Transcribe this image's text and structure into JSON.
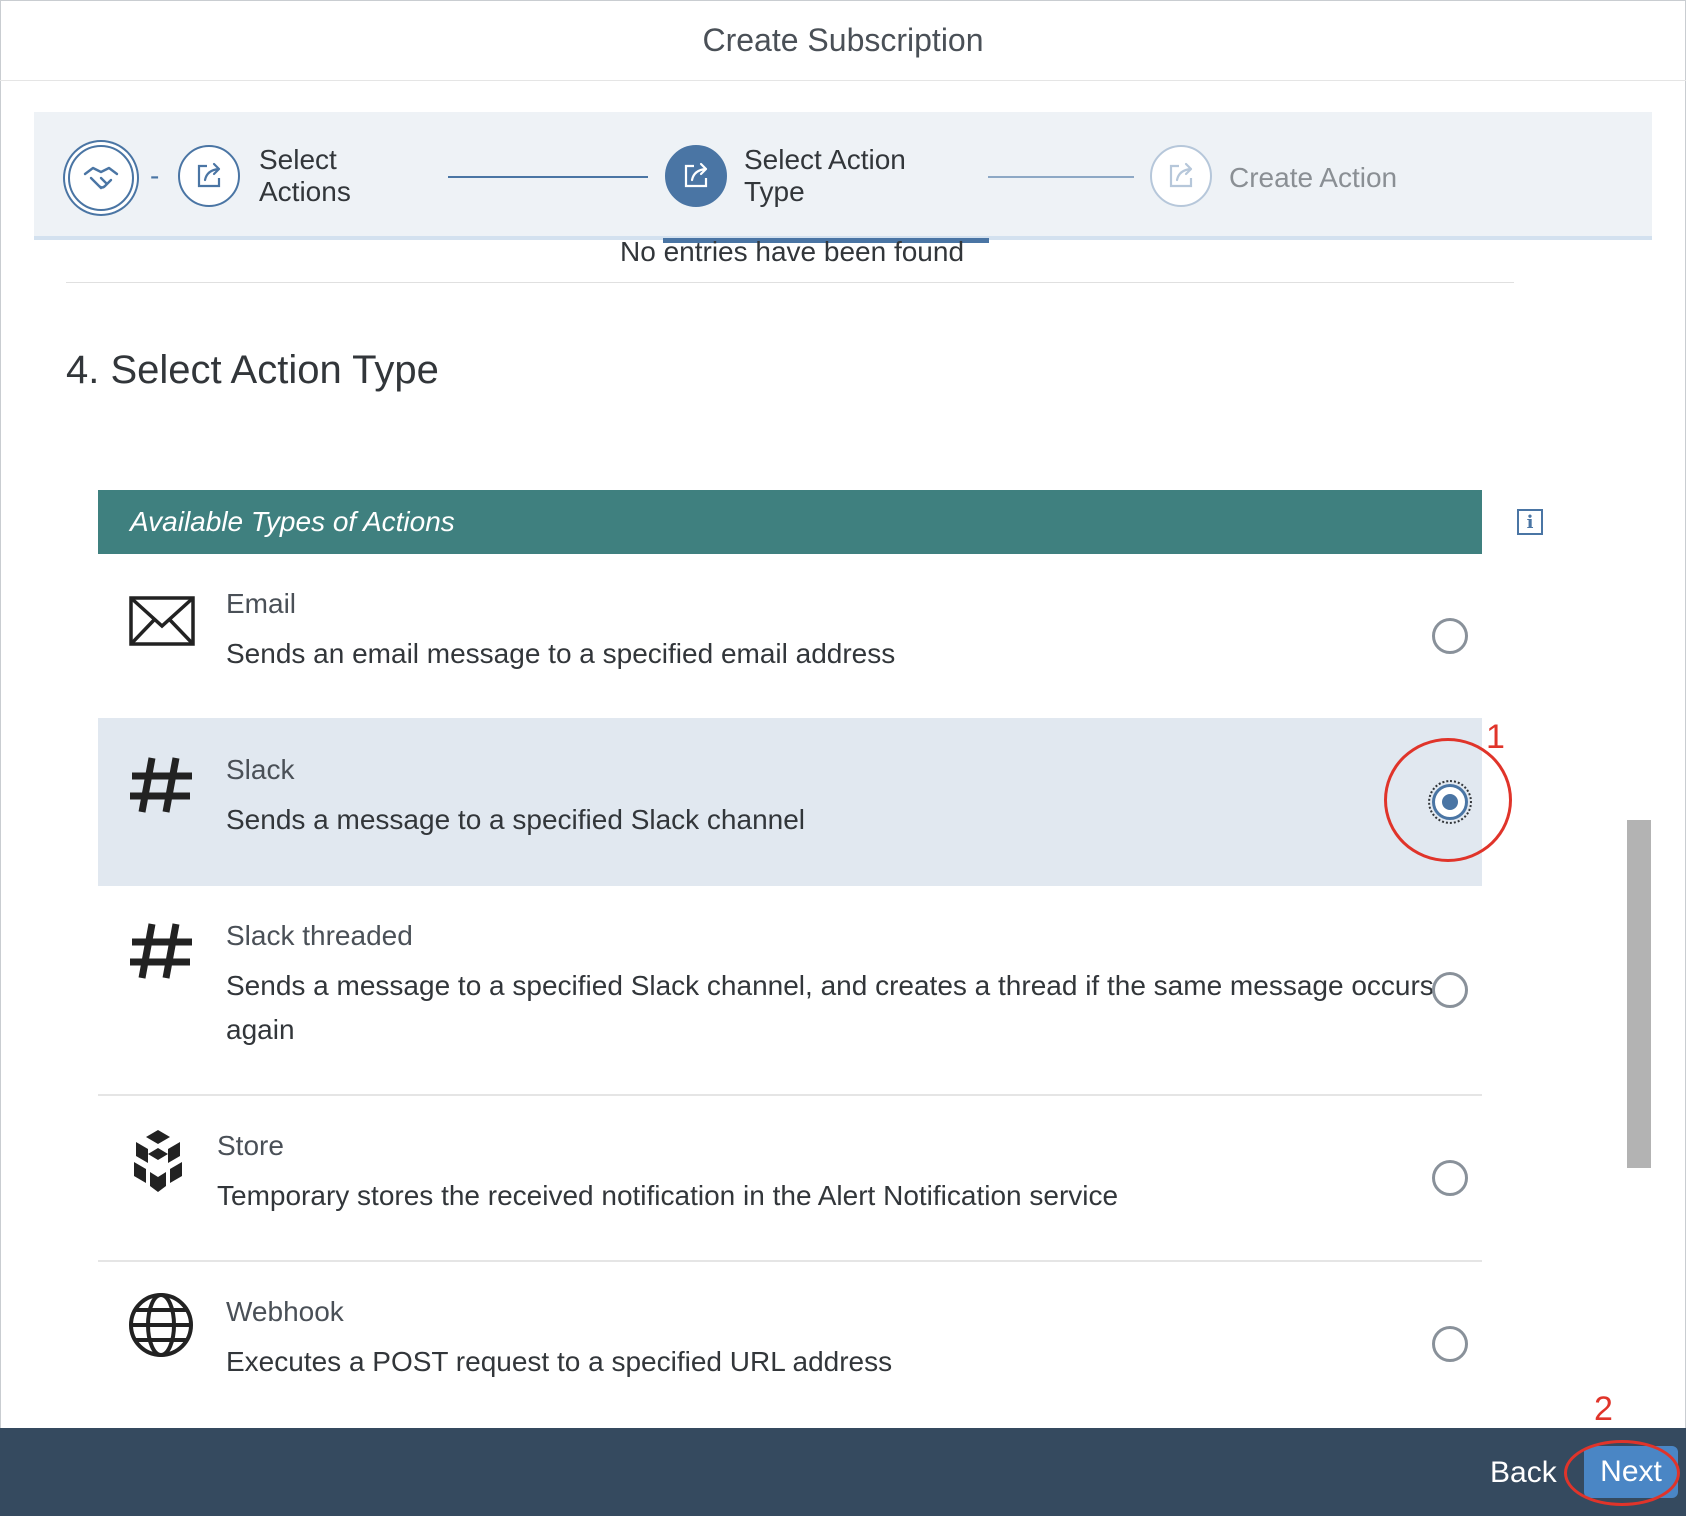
{
  "dialog": {
    "title": "Create Subscription"
  },
  "wizard": {
    "steps": [
      {
        "label": "Select Actions",
        "icon": "handshake-icon",
        "state": "completed"
      },
      {
        "label": "Select Action Type",
        "icon": "share-icon",
        "state": "active"
      },
      {
        "label": "Create Action",
        "icon": "share-icon",
        "state": "disabled"
      }
    ],
    "separator": "-"
  },
  "previous_section": {
    "empty_text": "No entries have been found"
  },
  "section": {
    "title": "4. Select Action Type"
  },
  "table": {
    "header": "Available Types of Actions",
    "info_icon": "info-icon",
    "rows": [
      {
        "title": "Email",
        "description": "Sends an email message to a specified email address",
        "icon": "envelope-icon",
        "selected": false
      },
      {
        "title": "Slack",
        "description": "Sends a message to a specified Slack channel",
        "icon": "hashtag-icon",
        "selected": true
      },
      {
        "title": "Slack threaded",
        "description_line1": "Sends a message to a specified Slack channel, and creates a thread if the same message occurs",
        "description_line2": "again",
        "icon": "hashtag-icon",
        "selected": false
      },
      {
        "title": "Store",
        "description": "Temporary stores the received notification in the Alert Notification service",
        "icon": "cube-stack-icon",
        "selected": false
      },
      {
        "title": "Webhook",
        "description": "Executes a POST request to a specified URL address",
        "icon": "globe-icon",
        "selected": false
      }
    ]
  },
  "annotations": {
    "marker1": "1",
    "marker2": "2",
    "color": "#e0342a"
  },
  "footer": {
    "back_label": "Back",
    "next_label": "Next"
  },
  "colors": {
    "accent": "#4a75a4",
    "table_header": "#3f807f",
    "footer": "#354a5f",
    "selected_row": "#e1e8f0"
  }
}
